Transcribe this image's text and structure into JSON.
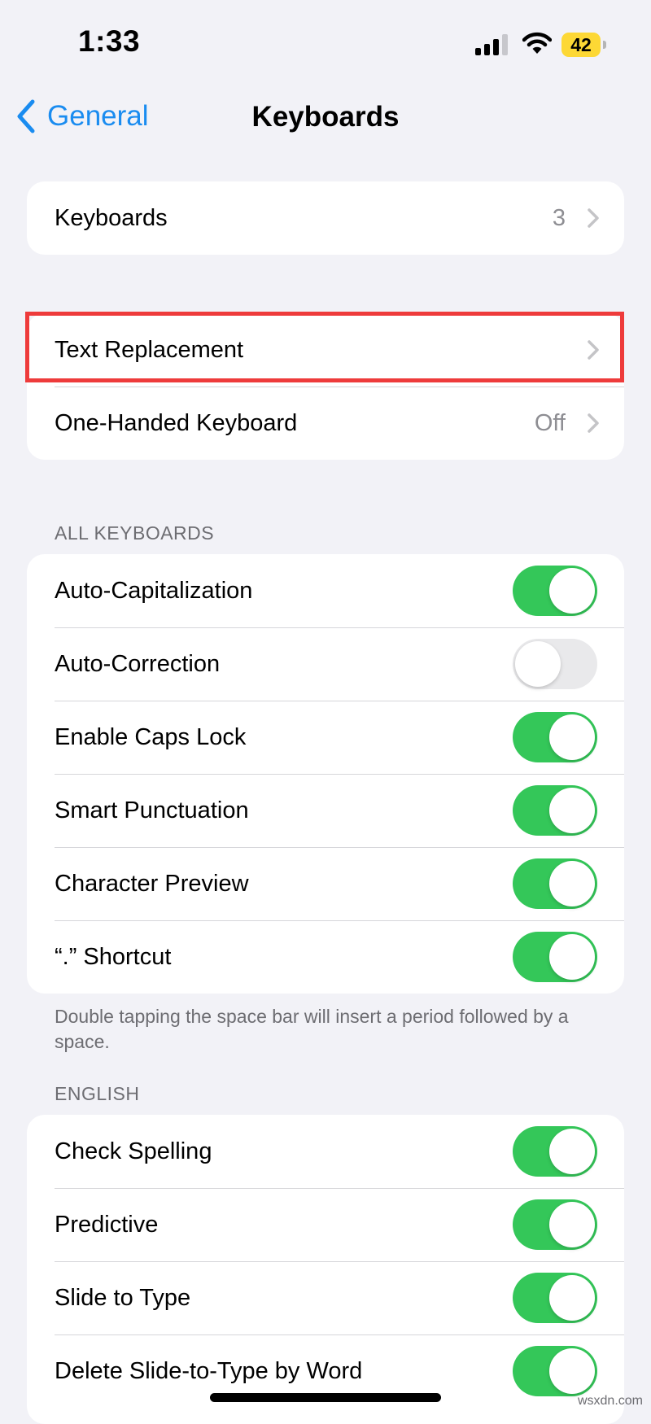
{
  "status_bar": {
    "time": "1:33",
    "battery": "42",
    "battery_color": "#fdd835"
  },
  "nav": {
    "back_label": "General",
    "title": "Keyboards"
  },
  "group1": {
    "keyboards_label": "Keyboards",
    "keyboards_count": "3"
  },
  "group2": {
    "text_replacement_label": "Text Replacement",
    "one_handed_label": "One-Handed Keyboard",
    "one_handed_value": "Off"
  },
  "all_keyboards": {
    "header": "ALL KEYBOARDS",
    "items": [
      {
        "label": "Auto-Capitalization",
        "on": true
      },
      {
        "label": "Auto-Correction",
        "on": false
      },
      {
        "label": "Enable Caps Lock",
        "on": true
      },
      {
        "label": "Smart Punctuation",
        "on": true
      },
      {
        "label": "Character Preview",
        "on": true
      },
      {
        "label": "“.” Shortcut",
        "on": true
      }
    ],
    "footnote": "Double tapping the space bar will insert a period followed by a space."
  },
  "english": {
    "header": "ENGLISH",
    "items": [
      {
        "label": "Check Spelling",
        "on": true
      },
      {
        "label": "Predictive",
        "on": true
      },
      {
        "label": "Slide to Type",
        "on": true
      },
      {
        "label": "Delete Slide-to-Type by Word",
        "on": true
      }
    ]
  },
  "colors": {
    "accent": "#1a8cf0",
    "toggle_on": "#34c759",
    "highlight_box": "#ee3b3b",
    "background": "#f2f2f7"
  },
  "watermark": "wsxdn.com"
}
